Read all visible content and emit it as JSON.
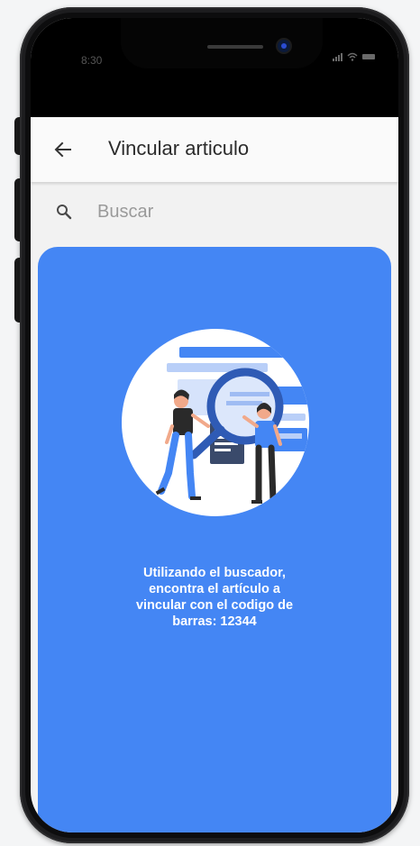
{
  "status_bar": {
    "time": "8:30",
    "icons": [
      "signal-icon",
      "wifi-icon",
      "battery-icon"
    ]
  },
  "app_bar": {
    "back_icon": "arrow-left-icon",
    "title": "Vincular articulo"
  },
  "search": {
    "icon": "search-icon",
    "placeholder": "Buscar",
    "value": ""
  },
  "empty_state": {
    "illustration": "people-searching-illustration",
    "message_lines": [
      "Utilizando el buscador,",
      "encontra el artículo a",
      "vincular con el codigo de",
      "barras: 12344"
    ]
  },
  "colors": {
    "panel_blue": "#4486f4",
    "app_bar_bg": "#fafafa",
    "phone_frame": "#1d1d1f"
  }
}
